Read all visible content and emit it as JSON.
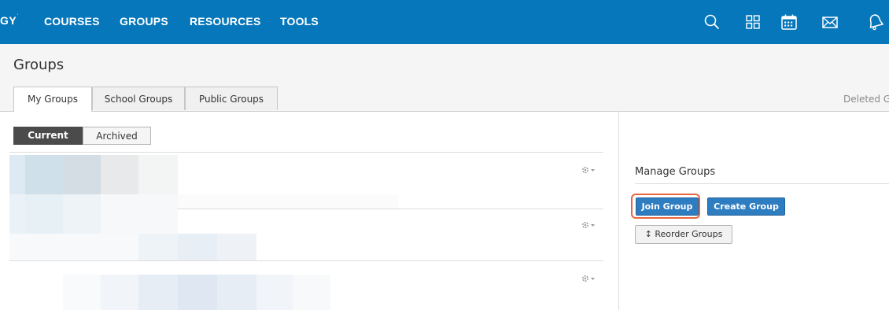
{
  "brand": {
    "logo_text": "GY",
    "logo_mark": "˙"
  },
  "nav": {
    "items": [
      "COURSES",
      "GROUPS",
      "RESOURCES",
      "TOOLS"
    ],
    "icons": [
      "search-icon",
      "apps-grid-icon",
      "calendar-icon",
      "mail-icon",
      "bell-icon"
    ]
  },
  "page": {
    "title": "Groups"
  },
  "tabs": [
    "My Groups",
    "School Groups",
    "Public Groups"
  ],
  "deleted_link": "Deleted G",
  "filter": {
    "current": "Current",
    "archived": "Archived"
  },
  "sidebar": {
    "title": "Manage Groups",
    "join_button": "Join Group",
    "create_button": "Create Group",
    "reorder_button": "↕ Reorder Groups"
  },
  "colors": {
    "topbar": "#0677ba",
    "primary_button": "#2f7dc1",
    "highlight": "#e8663d",
    "segment_active": "#4b4b4b"
  }
}
